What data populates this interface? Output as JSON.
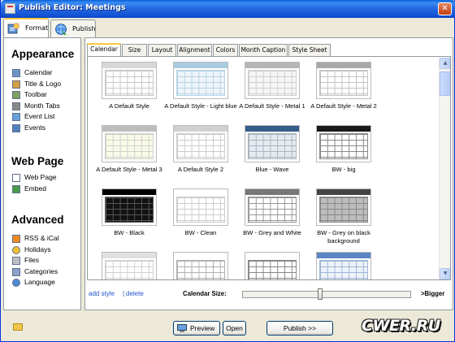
{
  "window": {
    "title": "Publish Editor: Meetings"
  },
  "top_tabs": [
    {
      "label": "Format",
      "icon": "format-icon",
      "active": true
    },
    {
      "label": "Publish",
      "icon": "publish-icon",
      "active": false
    }
  ],
  "sidebar": {
    "appearance": {
      "title": "Appearance",
      "items": [
        {
          "label": "Calendar",
          "icon": "calendar-icon"
        },
        {
          "label": "Title & Logo",
          "icon": "title-logo-icon"
        },
        {
          "label": "Toolbar",
          "icon": "toolbar-icon"
        },
        {
          "label": "Month Tabs",
          "icon": "month-tabs-icon"
        },
        {
          "label": "Event List",
          "icon": "event-list-icon"
        },
        {
          "label": "Events",
          "icon": "events-icon"
        }
      ]
    },
    "webpage": {
      "title": "Web Page",
      "items": [
        {
          "label": "Web Page",
          "icon": "web-page-icon"
        },
        {
          "label": "Embed",
          "icon": "embed-icon"
        }
      ]
    },
    "advanced": {
      "title": "Advanced",
      "items": [
        {
          "label": "RSS & iCal",
          "icon": "rss-icon"
        },
        {
          "label": "Holidays",
          "icon": "holidays-icon"
        },
        {
          "label": "Files",
          "icon": "files-icon"
        },
        {
          "label": "Categories",
          "icon": "categories-icon"
        },
        {
          "label": "Language",
          "icon": "language-icon"
        }
      ]
    }
  },
  "subtabs": [
    {
      "label": "Calendar",
      "active": true
    },
    {
      "label": "Size",
      "active": false
    },
    {
      "label": "Layout",
      "active": false
    },
    {
      "label": "Alignment",
      "active": false
    },
    {
      "label": "Colors",
      "active": false
    },
    {
      "label": "Month Caption",
      "active": false
    },
    {
      "label": "Style Sheet",
      "active": false
    }
  ],
  "styles": [
    {
      "name": "A Default Style",
      "header": "#d8d8d8",
      "line": "#c8c8c8",
      "bg": "#ffffff"
    },
    {
      "name": "A Default Style - Light blue",
      "header": "#a9cbe0",
      "line": "#b7d3e4",
      "bg": "#eef5fa"
    },
    {
      "name": "A Default Style - Metal 1",
      "header": "#b5b5b5",
      "line": "#cfcfcf",
      "bg": "#f6f6f6"
    },
    {
      "name": "A Default Style - Metal 2",
      "header": "#a8a8a8",
      "line": "#c3c3c3",
      "bg": "#ffffff"
    },
    {
      "name": "A Default Style - Metal 3",
      "header": "#bdbdbd",
      "line": "#cfcfcf",
      "bg": "#fafbe6"
    },
    {
      "name": "A Default Style 2",
      "header": "#d0d0d0",
      "line": "#cccccc",
      "bg": "#ffffff"
    },
    {
      "name": "Blue - Wave",
      "header": "#355d8a",
      "line": "#aab4c0",
      "bg": "#e6ebf0"
    },
    {
      "name": "BW - big",
      "header": "#1a1a1a",
      "line": "#888888",
      "bg": "#ffffff"
    },
    {
      "name": "BW - Black",
      "header": "#000000",
      "line": "#555555",
      "bg": "#111111"
    },
    {
      "name": "BW - Clean",
      "header": "#ffffff",
      "line": "#cccccc",
      "bg": "#ffffff"
    },
    {
      "name": "BW - Grey and White",
      "header": "#777777",
      "line": "#999999",
      "bg": "#ffffff"
    },
    {
      "name": "BW - Grey on black background",
      "header": "#444444",
      "line": "#888888",
      "bg": "#bdbdbd"
    },
    {
      "name": "",
      "header": "#e0e0e0",
      "line": "#d0d0d0",
      "bg": "#ffffff"
    },
    {
      "name": "",
      "header": "#ffffff",
      "line": "#b0b0b0",
      "bg": "#ffffff"
    },
    {
      "name": "",
      "header": "#ffffff",
      "line": "#888888",
      "bg": "#ffffff"
    },
    {
      "name": "",
      "header": "#5a86c4",
      "line": "#9fb6d6",
      "bg": "#eef3fa"
    }
  ],
  "style_links": {
    "add": "add style",
    "separator": "|",
    "delete": "delete"
  },
  "calendar_size": {
    "label": "Calendar Size:",
    "value": 0.46,
    "bigger": ">Bigger"
  },
  "footer": {
    "preview": "Preview",
    "open": "Open",
    "publish": "Publish >>",
    "watermark": "CWER.RU"
  }
}
